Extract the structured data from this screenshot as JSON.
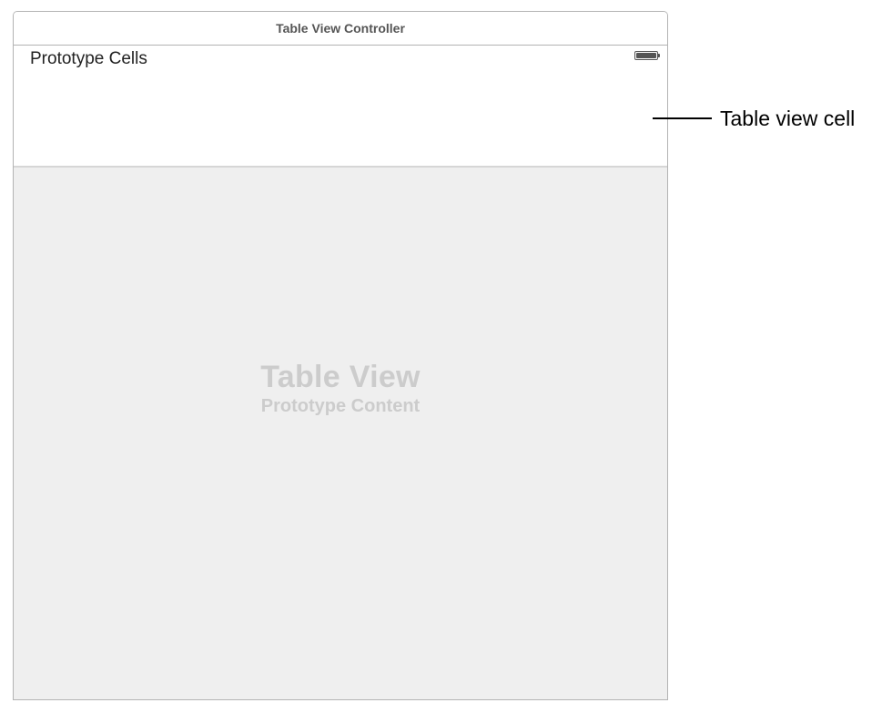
{
  "scene": {
    "title": "Table View Controller",
    "prototype_header": {
      "label": "Prototype Cells",
      "status_icon": "battery-icon"
    },
    "placeholder": {
      "title": "Table View",
      "subtitle": "Prototype Content"
    }
  },
  "callout": {
    "label": "Table view cell"
  }
}
